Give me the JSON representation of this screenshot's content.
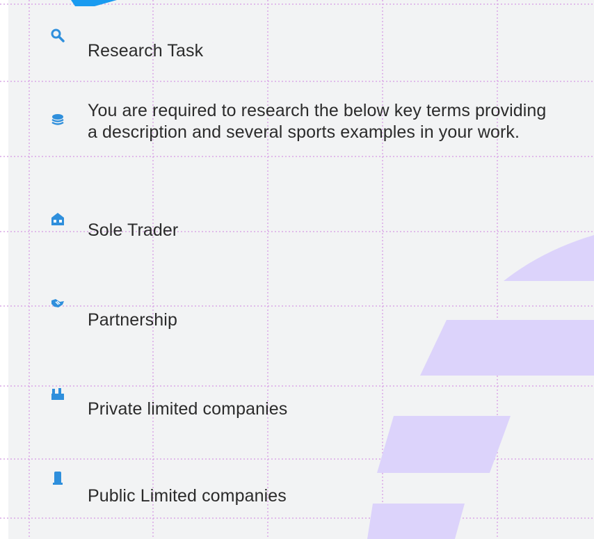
{
  "items": [
    {
      "icon": "magnifier-icon",
      "text": "Research Task"
    },
    {
      "icon": "stacked-layers-icon",
      "text": "You are required to research the below key terms providing a description and several sports examples in your work."
    },
    {
      "icon": "house-icon",
      "text": "Sole Trader"
    },
    {
      "icon": "handshake-icon",
      "text": "Partnership"
    },
    {
      "icon": "factory-icon",
      "text": "Private limited companies"
    },
    {
      "icon": "tower-building-icon",
      "text": "Public Limited companies"
    }
  ],
  "colors": {
    "background": "#f2f3f4",
    "grid": "#d9a8e6",
    "icon_blue": "#2f8fdc",
    "accent_purple": "#dcd3fb",
    "top_tab_blue": "#1a9bf0"
  }
}
